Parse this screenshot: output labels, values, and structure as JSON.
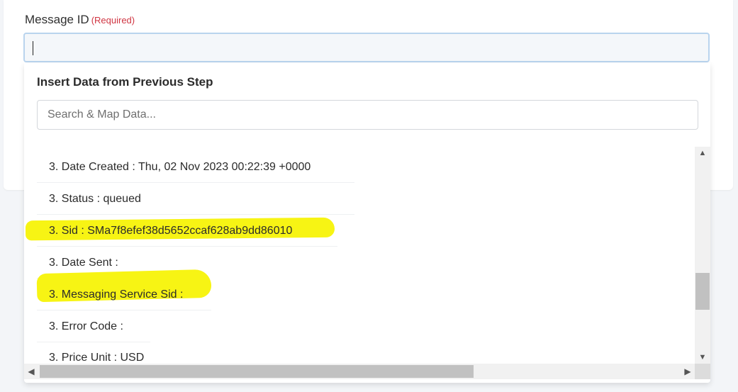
{
  "field": {
    "label": "Message ID",
    "required": "(Required)",
    "value": "",
    "placeholder": ""
  },
  "dropdown": {
    "heading": "Insert Data from Previous Step",
    "search_placeholder": "Search & Map Data...",
    "items": [
      {
        "label": "3. Date Created : Thu, 02 Nov 2023 00:22:39 +0000",
        "highlighted": false
      },
      {
        "label": "3. Status : queued",
        "highlighted": false
      },
      {
        "label": "3. Sid : SMa7f8efef38d5652ccaf628ab9dd86010",
        "highlighted": true
      },
      {
        "label": "3. Date Sent :",
        "highlighted": false
      },
      {
        "label": "3. Messaging Service Sid :",
        "highlighted": true
      },
      {
        "label": "3. Error Code :",
        "highlighted": false
      },
      {
        "label": "3. Price Unit : USD",
        "highlighted": false
      }
    ]
  },
  "colors": {
    "highlight": "#f7f414",
    "required": "#d03542",
    "input_border": "#b9d4ee"
  },
  "icons": {
    "scroll_up": "▲",
    "scroll_down": "▼",
    "scroll_left": "◀",
    "scroll_right": "▶"
  }
}
